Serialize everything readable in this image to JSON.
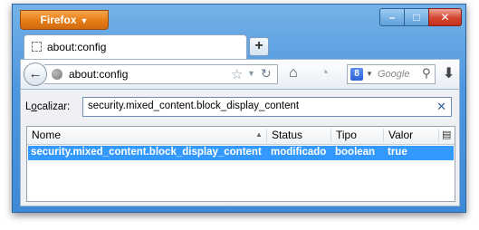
{
  "browser": {
    "menu_button_label": "Firefox",
    "window_controls": {
      "minimize": "–",
      "maximize": "□",
      "close": "✕"
    }
  },
  "tabs": [
    {
      "title": "about:config"
    }
  ],
  "new_tab_symbol": "+",
  "navbar": {
    "url": "about:config",
    "search_engine_icon": "8",
    "search_placeholder": "Google"
  },
  "filter": {
    "label_prefix": "L",
    "label_underlined": "o",
    "label_suffix": "calizar:",
    "value": "security.mixed_content.block_display_content",
    "clear_symbol": "✕"
  },
  "table": {
    "columns": [
      "Nome",
      "Status",
      "Tipo",
      "Valor"
    ],
    "rows": [
      {
        "name": "security.mixed_content.block_display_content",
        "status": "modificado",
        "type": "boolean",
        "value": "true"
      }
    ]
  },
  "icons": {
    "back": "back-arrow-icon",
    "site": "globe-icon",
    "bookmark": "star-icon",
    "reload": "reload-icon",
    "home": "home-icon",
    "rss": "rss-feed-icon",
    "search": "magnifier-icon",
    "downloads": "download-arrow-icon"
  }
}
